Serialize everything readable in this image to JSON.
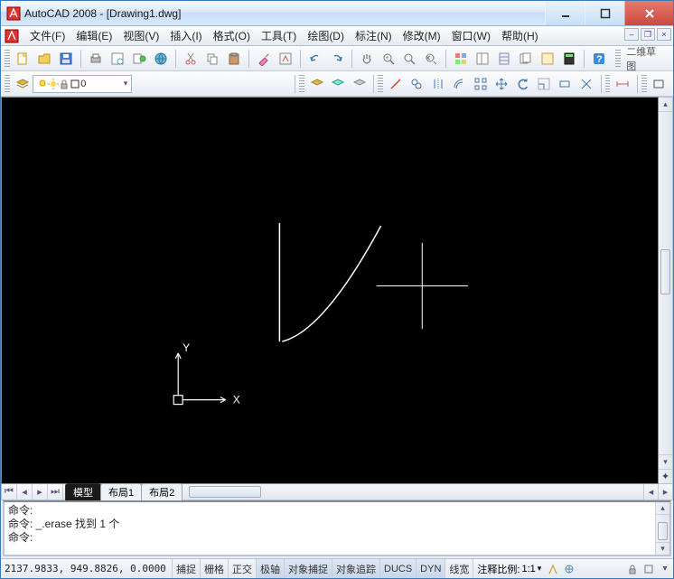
{
  "title": "AutoCAD 2008 - [Drawing1.dwg]",
  "menu": {
    "items": [
      "文件(F)",
      "编辑(E)",
      "视图(V)",
      "插入(I)",
      "格式(O)",
      "工具(T)",
      "绘图(D)",
      "标注(N)",
      "修改(M)",
      "窗口(W)",
      "帮助(H)"
    ]
  },
  "toolbar1_right": "二维草图",
  "layer": {
    "name": "0"
  },
  "drawing": {
    "ucs": {
      "x_label": "X",
      "y_label": "Y"
    }
  },
  "tabs": {
    "model": "模型",
    "layout1": "布局1",
    "layout2": "布局2"
  },
  "command": {
    "line1": "命令:",
    "line2": "命令: _.erase 找到 1 个",
    "line3": "命令:"
  },
  "status": {
    "coords": "2137.9833, 949.8826, 0.0000",
    "buttons": [
      "捕捉",
      "栅格",
      "正交",
      "极轴",
      "对象捕捉",
      "对象追踪",
      "DUCS",
      "DYN",
      "线宽"
    ],
    "active_idx": [
      3,
      4,
      5,
      6,
      7
    ],
    "anno_label": "注释比例:",
    "anno_scale": "1:1"
  },
  "icons": {
    "search": "search-icon",
    "gear": "gear-icon"
  }
}
